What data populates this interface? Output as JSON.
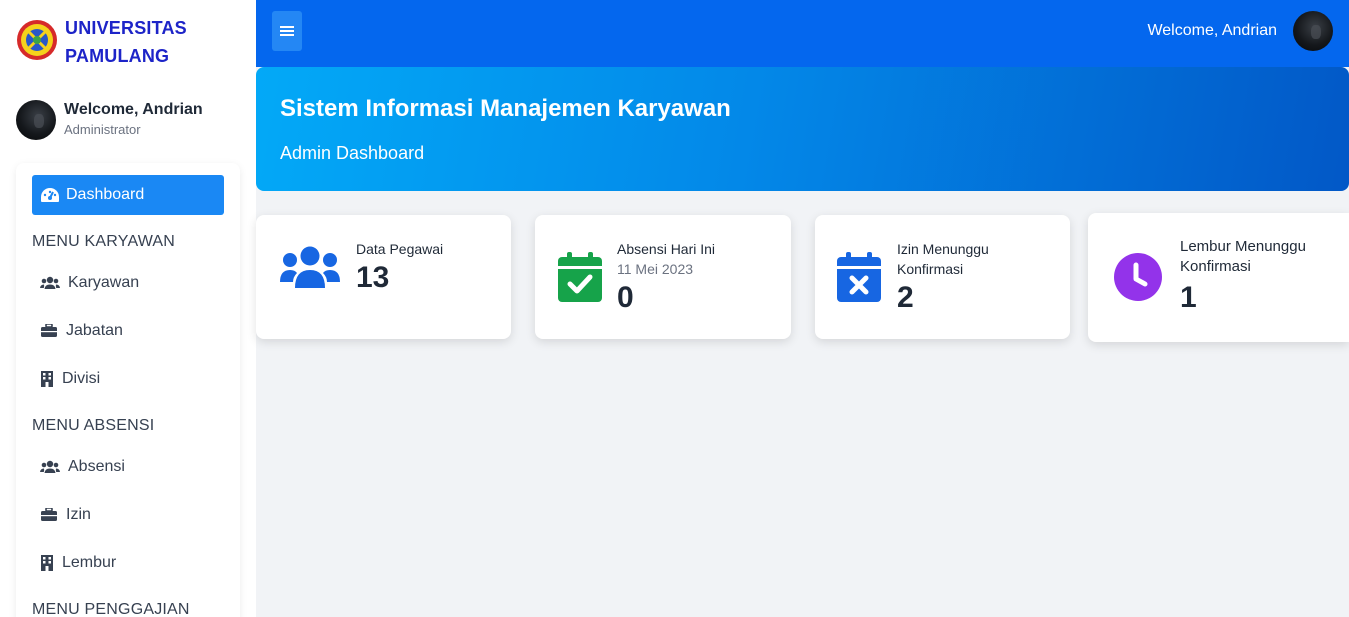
{
  "brand": {
    "line1": "UNIVERSITAS",
    "line2": "PAMULANG"
  },
  "sidebar_user": {
    "name": "Welcome, Andrian",
    "role": "Administrator"
  },
  "menu": {
    "active": "Dashboard",
    "sections": [
      {
        "heading": "MENU KARYAWAN",
        "items": [
          "Karyawan",
          "Jabatan",
          "Divisi"
        ]
      },
      {
        "heading": "MENU ABSENSI",
        "items": [
          "Absensi",
          "Izin",
          "Lembur"
        ]
      },
      {
        "heading": "MENU PENGGAJIAN",
        "items": []
      }
    ]
  },
  "header": {
    "welcome": "Welcome, Andrian"
  },
  "hero": {
    "title": "Sistem Informasi Manajemen Karyawan",
    "subtitle": "Admin Dashboard"
  },
  "stats": [
    {
      "label": "Data Pegawai",
      "value": "13",
      "icon": "users-icon",
      "color": "#1766e2"
    },
    {
      "label": "Absensi Hari Ini",
      "sublabel": "11 Mei 2023",
      "value": "0",
      "icon": "calendar-check-icon",
      "color": "#16a34a"
    },
    {
      "label_line1": "Izin Menunggu",
      "label_line2": "Konfirmasi",
      "value": "2",
      "icon": "calendar-x-icon",
      "color": "#1766e2"
    },
    {
      "label_line1": "Lembur Menunggu",
      "label_line2": "Konfirmasi",
      "value": "1",
      "icon": "clock-icon",
      "color": "#9333ea"
    }
  ],
  "colors": {
    "topbar": "#0467ee",
    "active_menu": "#1a88f4",
    "brand_text": "#1d24c8"
  }
}
